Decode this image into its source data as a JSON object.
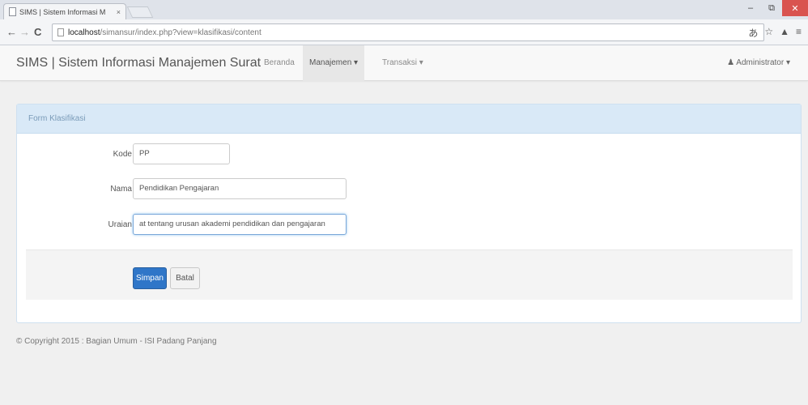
{
  "browser": {
    "tab_title": "SIMS | Sistem Informasi M",
    "tab_close": "×",
    "url_host": "localhost",
    "url_path": "/simansur/index.php?view=klasifikasi/content",
    "back_glyph": "←",
    "forward_glyph": "→",
    "reload_glyph": "C",
    "minimize_glyph": "–",
    "maximize_glyph": "⧉",
    "close_glyph": "✕",
    "star_glyph": "☆",
    "menu_glyph": "≡",
    "translate_glyph": "あ",
    "ext_glyph": "▲"
  },
  "navbar": {
    "brand": "SIMS | Sistem Informasi Manajemen Surat",
    "items": [
      {
        "label": "Beranda"
      },
      {
        "label": "Manajemen ▾"
      },
      {
        "label": "Transaksi ▾"
      }
    ],
    "user": "Administrator"
  },
  "form": {
    "heading": "Form Klasifikasi",
    "fields": [
      {
        "label": "Kode",
        "value": "PP"
      },
      {
        "label": "Nama",
        "value": "Pendidikan Pengajaran"
      },
      {
        "label": "Uraian",
        "value": "at tentang urusan akademi pendidikan dan pengajaran"
      }
    ],
    "save_label": "Simpan",
    "cancel_label": "Batal"
  },
  "footer": {
    "copyright": "© Copyright 2015 : Bagian Umum - ISI Padang Panjang"
  },
  "colors": {
    "primary": "#2f76c8",
    "panel_heading": "#d9e9f7",
    "close_button": "#d9534f"
  }
}
